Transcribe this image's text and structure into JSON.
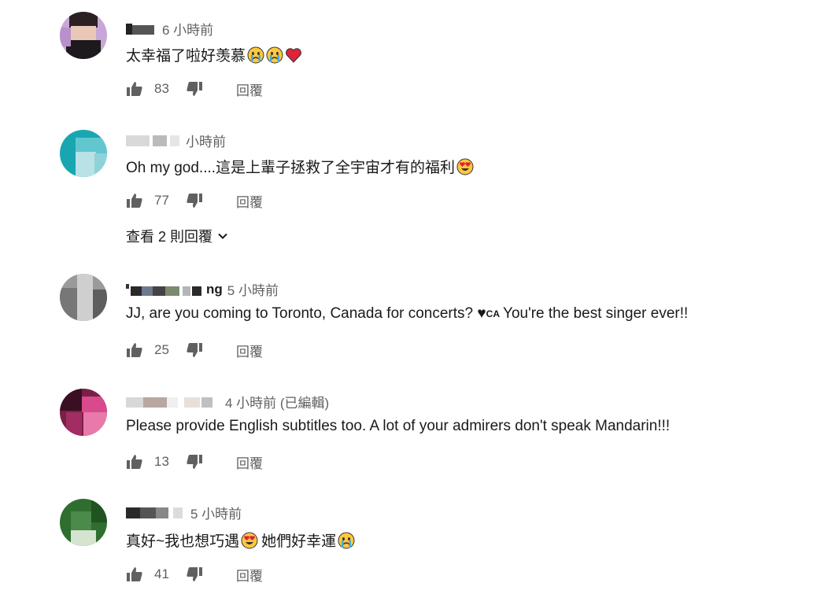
{
  "comments": [
    {
      "author": "",
      "time": "6 小時前",
      "text": "太幸福了啦好羡慕",
      "emojis": [
        "crying-face",
        "crying-face",
        "red-heart"
      ],
      "likes": "83",
      "reply_label": "回覆"
    },
    {
      "author": "",
      "time": "小時前",
      "text": "Oh my god....這是上輩子拯救了全宇宙才有的福利",
      "emojis": [
        "heart-eyes-face"
      ],
      "likes": "77",
      "reply_label": "回覆",
      "view_replies": "查看 2 則回覆"
    },
    {
      "author": "ng",
      "time": "5 小時前",
      "text_before": "JJ, are you coming to Toronto, Canada for concerts? ♥",
      "badge": "CA",
      "text_after": " You're the best singer ever!!",
      "likes": "25",
      "reply_label": "回覆"
    },
    {
      "author": "",
      "time": "4 小時前 (已編輯)",
      "text": "Please provide English subtitles too. A lot of your admirers don't speak Mandarin!!!",
      "likes": "13",
      "reply_label": "回覆"
    },
    {
      "author": "",
      "time": "5 小時前",
      "text_part1": "真好~我也想巧遇",
      "text_part2": "她們好幸運",
      "likes": "41",
      "reply_label": "回覆"
    }
  ],
  "colors": {
    "text": "#1a1a1a",
    "secondary": "#606060",
    "heart": "#e0223a"
  }
}
